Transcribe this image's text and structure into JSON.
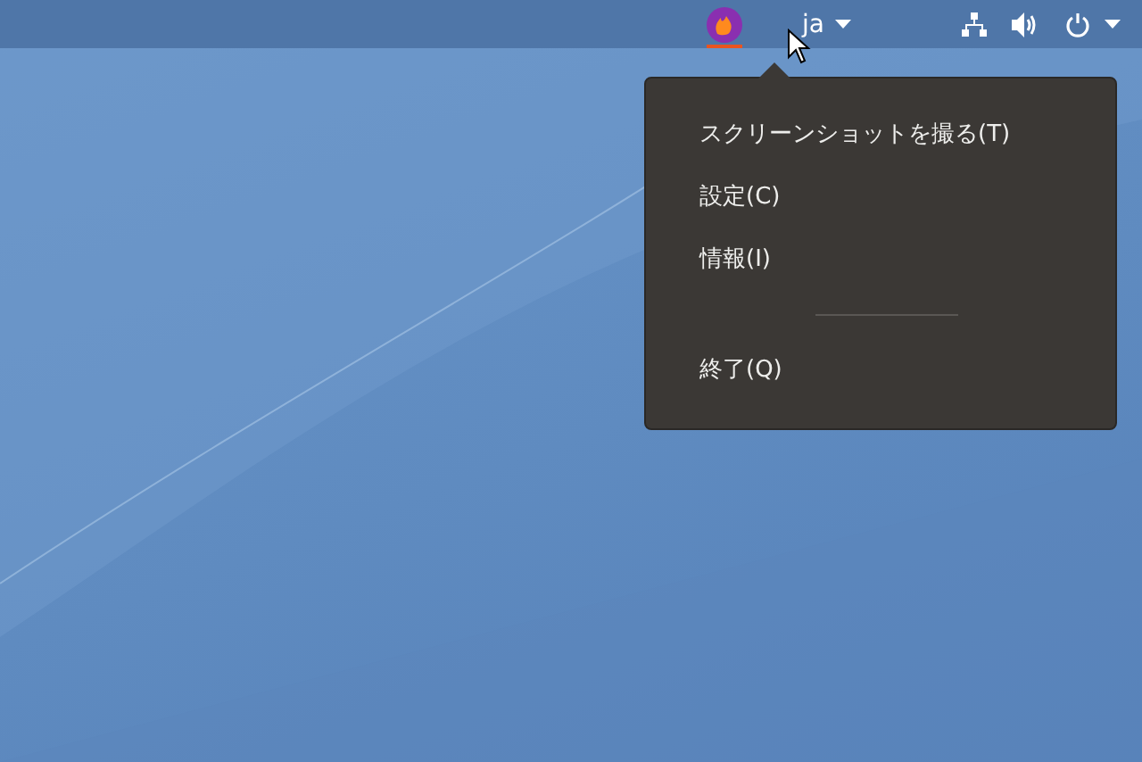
{
  "top_bar": {
    "app_indicator": {
      "menu_open": true
    },
    "language": "ja"
  },
  "menu": {
    "items": [
      {
        "kind": "item",
        "label": "スクリーンショットを撮る(T)"
      },
      {
        "kind": "item",
        "label": "設定(C)"
      },
      {
        "kind": "item",
        "label": "情報(I)"
      },
      {
        "kind": "separator"
      },
      {
        "kind": "item",
        "label": "終了(Q)"
      }
    ]
  }
}
